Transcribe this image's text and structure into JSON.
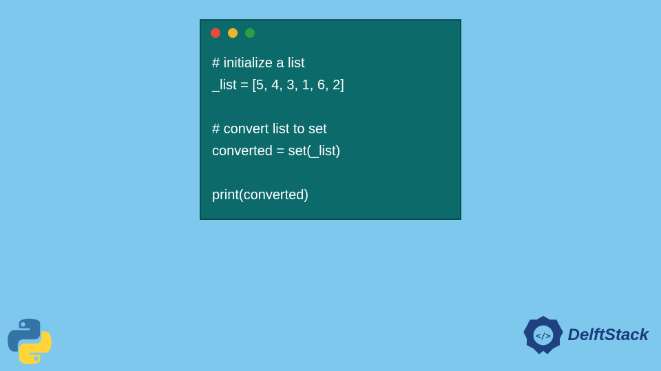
{
  "colors": {
    "background": "#7ec8ed",
    "window_bg": "#0d6a6a",
    "window_border": "#0a4f4f",
    "dot_red": "#e84b3c",
    "dot_yellow": "#f0b428",
    "dot_green": "#2aa042",
    "code_text": "#ffffff",
    "delft_blue": "#1a3a7a"
  },
  "code": {
    "line1": "# initialize a list",
    "line2": "_list = [5, 4, 3, 1, 6, 2]",
    "line3": "",
    "line4": "# convert list to set",
    "line5": "converted = set(_list)",
    "line6": "",
    "line7": "print(converted)"
  },
  "logos": {
    "python_icon": "python-logo",
    "delft_icon": "delftstack-emblem",
    "delft_text": "DelftStack"
  }
}
